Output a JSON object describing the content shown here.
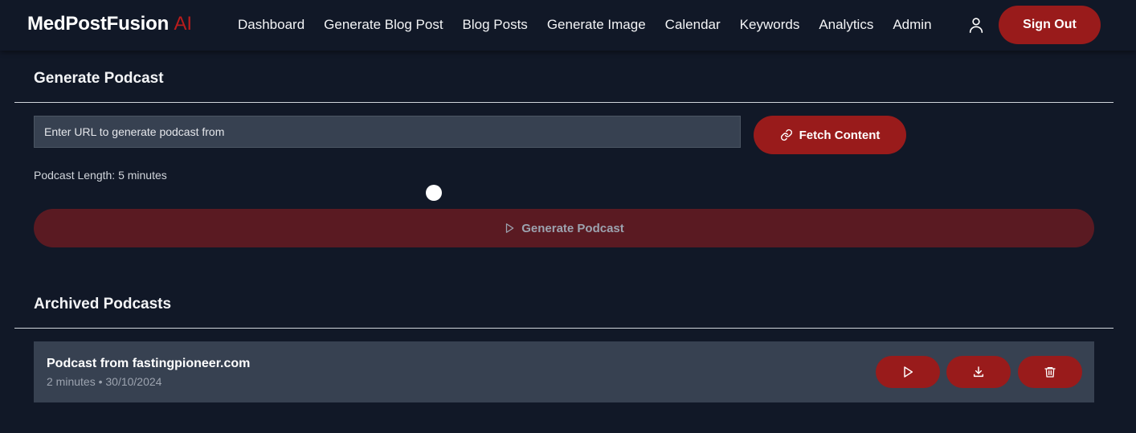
{
  "navbar": {
    "brand_main": "MedPostFusion",
    "brand_accent": "AI",
    "links": [
      {
        "label": "Dashboard"
      },
      {
        "label": "Generate Blog Post"
      },
      {
        "label": "Blog Posts"
      },
      {
        "label": "Generate Image"
      },
      {
        "label": "Calendar"
      },
      {
        "label": "Keywords"
      },
      {
        "label": "Analytics"
      },
      {
        "label": "Admin"
      }
    ],
    "user_icon": "user-icon",
    "sign_out_label": "Sign Out"
  },
  "generate": {
    "title": "Generate Podcast",
    "url_placeholder": "Enter URL to generate podcast from",
    "url_value": "",
    "fetch_label": "Fetch Content",
    "fetch_icon": "link-icon",
    "length_label": "Podcast Length: 5 minutes",
    "length_minutes": 5,
    "generate_label": "Generate Podcast",
    "generate_icon": "play-icon"
  },
  "archive": {
    "title": "Archived Podcasts",
    "items": [
      {
        "title": "Podcast from fastingpioneer.com",
        "meta": "2 minutes • 30/10/2024",
        "actions": [
          "play-icon",
          "download-icon",
          "trash-icon"
        ]
      }
    ]
  },
  "colors": {
    "background": "#111827",
    "accent": "#991b1b",
    "accent_disabled": "#5a1a22",
    "card": "#374151"
  }
}
